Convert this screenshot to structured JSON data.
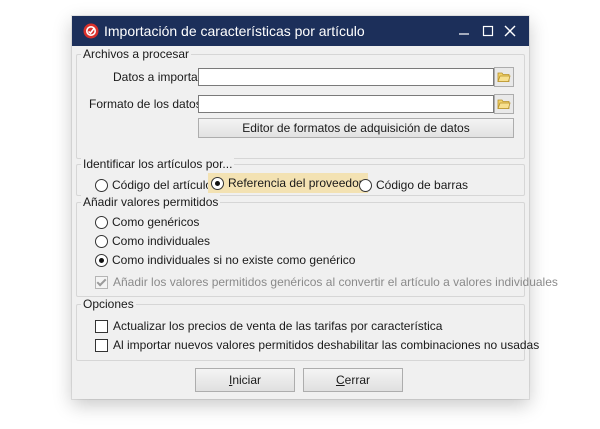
{
  "window": {
    "title": "Importación de características por artículo"
  },
  "files": {
    "group_title": "Archivos a procesar",
    "data_label": "Datos a importar:",
    "data_value": "",
    "format_label": "Formato de los datos:",
    "format_value": "",
    "editor_button": "Editor de formatos de adquisición de datos"
  },
  "identify": {
    "group_title": "Identificar los artículos por...",
    "options": [
      {
        "label": "Código del artículo",
        "selected": false
      },
      {
        "label": "Referencia del proveedor",
        "selected": true
      },
      {
        "label": "Código de barras",
        "selected": false
      }
    ]
  },
  "allowed": {
    "group_title": "Añadir valores permitidos",
    "options": [
      {
        "label": "Como genéricos",
        "selected": false
      },
      {
        "label": "Como individuales",
        "selected": false
      },
      {
        "label": "Como individuales si no existe como genérico",
        "selected": true
      }
    ],
    "add_generic_check": {
      "label": "Añadir los valores permitidos genéricos al convertir el artículo a valores individuales",
      "checked": true,
      "enabled": false
    }
  },
  "options": {
    "group_title": "Opciones",
    "checks": [
      {
        "label": "Actualizar los precios de venta de las tarifas por característica",
        "checked": false
      },
      {
        "label": "Al importar nuevos valores permitidos deshabilitar las combinaciones no usadas",
        "checked": false
      }
    ]
  },
  "buttons": {
    "start_first": "I",
    "start_rest": "niciar",
    "close_first": "C",
    "close_rest": "errar"
  },
  "colors": {
    "titlebar": "#1c2f5a",
    "dialog_bg": "#f0f0f0",
    "highlight": "#f3e2b3",
    "app_icon": "#d9302b"
  }
}
